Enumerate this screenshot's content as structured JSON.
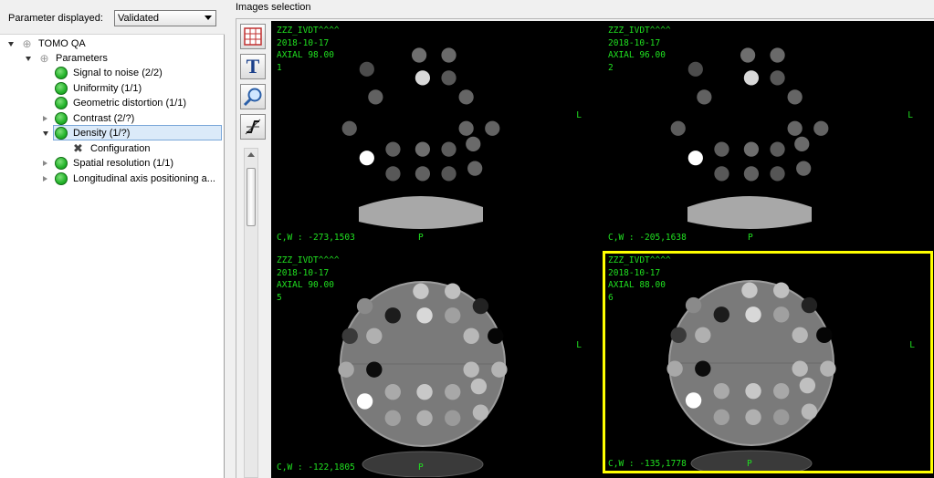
{
  "left_panel": {
    "param_label": "Parameter displayed:",
    "param_value": "Validated",
    "tree": {
      "root": "TOMO QA",
      "parameters": "Parameters",
      "items": [
        {
          "label": "Signal to noise (2/2)"
        },
        {
          "label": "Uniformity (1/1)"
        },
        {
          "label": "Geometric distortion (1/1)"
        },
        {
          "label": "Contrast (2/?)"
        },
        {
          "label": "Density (1/?)"
        },
        {
          "label": "Spatial resolution (1/1)"
        },
        {
          "label": "Longitudinal axis positioning a..."
        }
      ],
      "config_label": "Configuration"
    }
  },
  "right_panel": {
    "title": "Images selection",
    "toolbar": {
      "text_tool": "T"
    },
    "tiles": [
      {
        "patient": "ZZZ_IVDT^^^^",
        "date": "2018-10-17",
        "position": "AXIAL 98.00",
        "index": "1",
        "cw": "C,W : -273,1503",
        "orient_right": "L",
        "orient_bottom": "P"
      },
      {
        "patient": "ZZZ_IVDT^^^^",
        "date": "2018-10-17",
        "position": "AXIAL 96.00",
        "index": "2",
        "cw": "C,W : -205,1638",
        "orient_right": "L",
        "orient_bottom": "P"
      },
      {
        "patient": "ZZZ_IVDT^^^^",
        "date": "2018-10-17",
        "position": "AXIAL 90.00",
        "index": "5",
        "cw": "C,W : -122,1805",
        "orient_right": "L",
        "orient_bottom": "P"
      },
      {
        "patient": "ZZZ_IVDT^^^^",
        "date": "2018-10-17",
        "position": "AXIAL 88.00",
        "index": "6",
        "cw": "C,W : -135,1778",
        "orient_right": "L",
        "orient_bottom": "P"
      }
    ],
    "colors": {
      "overlay_text": "#20e020",
      "selection": "#ffff00",
      "status_ok": "#23b32a"
    }
  }
}
